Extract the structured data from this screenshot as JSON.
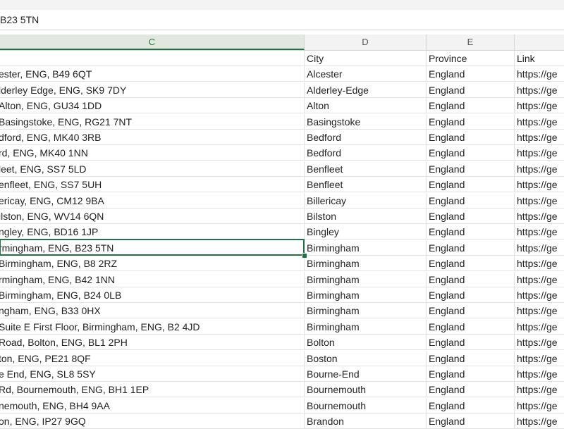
{
  "formula_bar": {
    "value": "B23 5TN"
  },
  "columns": [
    "C",
    "D",
    "E"
  ],
  "rows": [
    [
      "City",
      "Province",
      "Link"
    ],
    [
      "ester, ENG, B49 6QT",
      "Alcester",
      "England",
      "https://ge"
    ],
    [
      "lderley Edge, ENG, SK9 7DY",
      "Alderley-Edge",
      "England",
      "https://ge"
    ],
    [
      " Alton, ENG, GU34 1DD",
      "Alton",
      "England",
      "https://ge"
    ],
    [
      "Basingstoke, ENG, RG21 7NT",
      "Basingstoke",
      "England",
      "https://ge"
    ],
    [
      "dford, ENG, MK40 3RB",
      "Bedford",
      "England",
      "https://ge"
    ],
    [
      "rd, ENG, MK40 1NN",
      "Bedford",
      "England",
      "https://ge"
    ],
    [
      "leet, ENG, SS7 5LD",
      "Benfleet",
      "England",
      "https://ge"
    ],
    [
      "enfleet, ENG, SS7 5UH",
      "Benfleet",
      "England",
      "https://ge"
    ],
    [
      "ericay, ENG, CM12 9BA",
      "Billericay",
      "England",
      "https://ge"
    ],
    [
      "ilston, ENG, WV14 6QN",
      "Bilston",
      "England",
      "https://ge"
    ],
    [
      "ngley, ENG, BD16 1JP",
      "Bingley",
      "England",
      "https://ge"
    ],
    [
      "rmingham, ENG, B23 5TN",
      "Birmingham",
      "England",
      "https://ge"
    ],
    [
      " Birmingham, ENG, B8 2RZ",
      "Birmingham",
      "England",
      "https://ge"
    ],
    [
      "rmingham, ENG, B42 1NN",
      "Birmingham",
      "England",
      "https://ge"
    ],
    [
      " Birmingham, ENG, B24 0LB",
      "Birmingham",
      "England",
      "https://ge"
    ],
    [
      "ngham, ENG, B33 0HX",
      "Birmingham",
      "England",
      "https://ge"
    ],
    [
      " Suite E First Floor, Birmingham, ENG, B2 4JD",
      "Birmingham",
      "England",
      "https://ge"
    ],
    [
      "Road, Bolton, ENG, BL1 2PH",
      "Bolton",
      "England",
      "https://ge"
    ],
    [
      "ton, ENG, PE21 8QF",
      "Boston",
      "England",
      "https://ge"
    ],
    [
      "e End, ENG, SL8 5SY",
      "Bourne-End",
      "England",
      "https://ge"
    ],
    [
      " Rd, Bournemouth, ENG, BH1 1EP",
      "Bournemouth",
      "England",
      "https://ge"
    ],
    [
      "nemouth, ENG, BH4 9AA",
      "Bournemouth",
      "England",
      "https://ge"
    ],
    [
      "on, ENG, IP27 9GQ",
      "Brandon",
      "England",
      "https://ge"
    ]
  ]
}
